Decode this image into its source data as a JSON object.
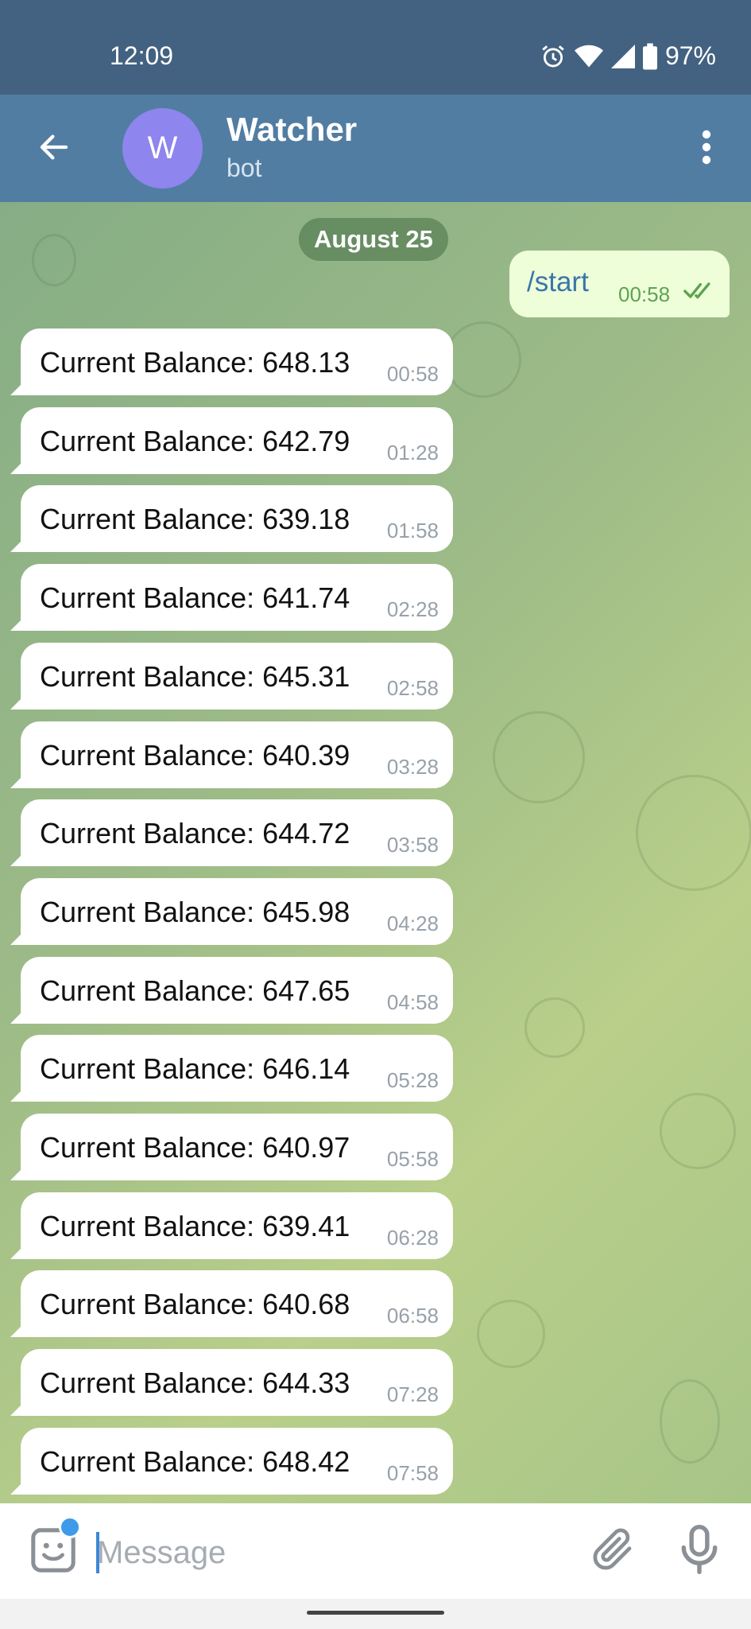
{
  "status_bar": {
    "time": "12:09",
    "battery": "97%"
  },
  "header": {
    "avatar_letter": "W",
    "title": "Watcher",
    "subtitle": "bot"
  },
  "chat": {
    "date": "August 25",
    "outgoing": {
      "text": "/start",
      "time": "00:58"
    },
    "incoming": [
      {
        "text": "Current Balance: 648.13",
        "time": "00:58"
      },
      {
        "text": "Current Balance: 642.79",
        "time": "01:28"
      },
      {
        "text": "Current Balance: 639.18",
        "time": "01:58"
      },
      {
        "text": "Current Balance: 641.74",
        "time": "02:28"
      },
      {
        "text": "Current Balance: 645.31",
        "time": "02:58"
      },
      {
        "text": "Current Balance: 640.39",
        "time": "03:28"
      },
      {
        "text": "Current Balance: 644.72",
        "time": "03:58"
      },
      {
        "text": "Current Balance: 645.98",
        "time": "04:28"
      },
      {
        "text": "Current Balance: 647.65",
        "time": "04:58"
      },
      {
        "text": "Current Balance: 646.14",
        "time": "05:28"
      },
      {
        "text": "Current Balance: 640.97",
        "time": "05:58"
      },
      {
        "text": "Current Balance: 639.41",
        "time": "06:28"
      },
      {
        "text": "Current Balance: 640.68",
        "time": "06:58"
      },
      {
        "text": "Current Balance: 644.33",
        "time": "07:28"
      },
      {
        "text": "Current Balance: 648.42",
        "time": "07:58"
      }
    ]
  },
  "composer": {
    "placeholder": "Message"
  },
  "icons": {
    "back": "arrow-left-icon",
    "menu": "more-vert-icon",
    "emoji": "sticker-emoji-icon",
    "attach": "paperclip-icon",
    "mic": "microphone-icon",
    "alarm": "alarm-icon",
    "wifi": "wifi-icon",
    "signal": "signal-icon",
    "battery": "battery-icon",
    "read": "double-check-icon"
  },
  "colors": {
    "header": "#527da3",
    "status_bar": "#436281",
    "avatar": "#8e85ee",
    "outgoing_bubble": "#eefed8",
    "accent": "#3d9bea"
  }
}
